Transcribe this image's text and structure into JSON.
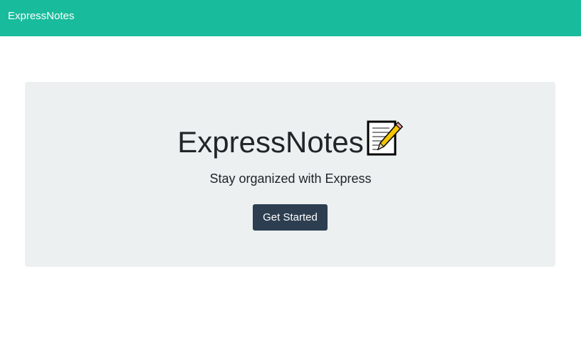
{
  "navbar": {
    "brand": "ExpressNotes",
    "background_color": "#18bc9c"
  },
  "hero": {
    "title": "ExpressNotes",
    "title_icon": "memo-icon",
    "subtitle": "Stay organized with Express",
    "cta_label": "Get Started",
    "cta_color": "#2c3e50",
    "panel_color": "#ecf0f1"
  }
}
